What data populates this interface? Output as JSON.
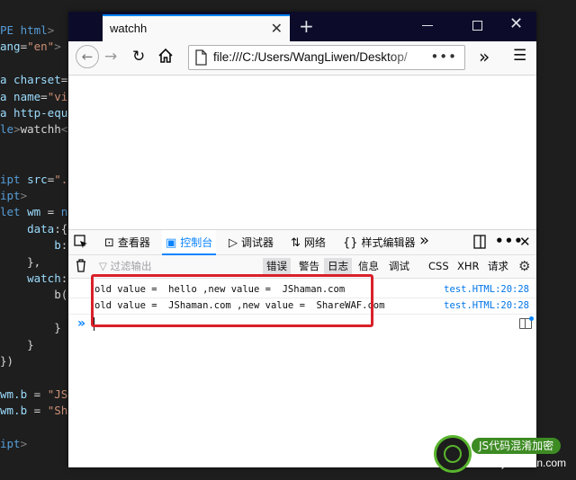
{
  "editor": {
    "lines": [
      {
        "parts": [
          {
            "c": "kw",
            "t": "PE html"
          },
          {
            "c": "tag",
            "t": ">"
          }
        ]
      },
      {
        "parts": [
          {
            "c": "attr",
            "t": "ang"
          },
          {
            "c": "txt",
            "t": "="
          },
          {
            "c": "str",
            "t": "\"en\""
          },
          {
            "c": "tag",
            "t": ">"
          }
        ]
      },
      {
        "parts": []
      },
      {
        "parts": [
          {
            "c": "attr",
            "t": "a charset"
          },
          {
            "c": "txt",
            "t": "="
          },
          {
            "c": "str",
            "t": "\""
          }
        ]
      },
      {
        "parts": [
          {
            "c": "attr",
            "t": "a name"
          },
          {
            "c": "txt",
            "t": "="
          },
          {
            "c": "str",
            "t": "\"vie"
          }
        ]
      },
      {
        "parts": [
          {
            "c": "attr",
            "t": "a http-equi"
          }
        ]
      },
      {
        "parts": [
          {
            "c": "kw",
            "t": "le"
          },
          {
            "c": "tag",
            "t": ">"
          },
          {
            "c": "txt",
            "t": "watchh"
          },
          {
            "c": "tag",
            "t": "</"
          }
        ]
      },
      {
        "parts": []
      },
      {
        "parts": []
      },
      {
        "parts": [
          {
            "c": "kw",
            "t": "ipt"
          },
          {
            "c": "attr",
            "t": " src"
          },
          {
            "c": "txt",
            "t": "="
          },
          {
            "c": "str",
            "t": "\"./"
          }
        ]
      },
      {
        "parts": [
          {
            "c": "kw",
            "t": "ipt"
          },
          {
            "c": "tag",
            "t": ">"
          }
        ]
      },
      {
        "parts": [
          {
            "c": "kw",
            "t": "let"
          },
          {
            "c": "prop",
            "t": " wm"
          },
          {
            "c": "txt",
            "t": " = "
          },
          {
            "c": "kw",
            "t": "ne"
          }
        ]
      },
      {
        "parts": [
          {
            "c": "prop",
            "t": "    data"
          },
          {
            "c": "txt",
            "t": ":{"
          }
        ]
      },
      {
        "parts": [
          {
            "c": "prop",
            "t": "        b"
          },
          {
            "c": "txt",
            "t": ":"
          }
        ]
      },
      {
        "parts": [
          {
            "c": "txt",
            "t": "    },"
          }
        ]
      },
      {
        "parts": [
          {
            "c": "prop",
            "t": "    watch"
          },
          {
            "c": "txt",
            "t": ":{"
          }
        ]
      },
      {
        "parts": [
          {
            "c": "txt",
            "t": "        b(n"
          }
        ]
      },
      {
        "parts": []
      },
      {
        "parts": [
          {
            "c": "txt",
            "t": "        }"
          }
        ]
      },
      {
        "parts": [
          {
            "c": "txt",
            "t": "    }"
          }
        ]
      },
      {
        "parts": [
          {
            "c": "txt",
            "t": "})"
          }
        ]
      },
      {
        "parts": []
      },
      {
        "parts": [
          {
            "c": "prop",
            "t": "wm.b"
          },
          {
            "c": "txt",
            "t": " = "
          },
          {
            "c": "str",
            "t": "\"JSh"
          }
        ]
      },
      {
        "parts": [
          {
            "c": "prop",
            "t": "wm.b"
          },
          {
            "c": "txt",
            "t": " = "
          },
          {
            "c": "str",
            "t": "\"Sha"
          }
        ]
      },
      {
        "parts": []
      },
      {
        "parts": [
          {
            "c": "kw",
            "t": "ipt"
          },
          {
            "c": "tag",
            "t": ">"
          }
        ]
      }
    ]
  },
  "browser": {
    "tab_title": "watchh",
    "tab_close": "✕",
    "new_tab": "+",
    "win_close": "✕",
    "url": "file:///C:/Users/WangLiwen/Desktop/",
    "url_more": "•••",
    "overflow": "»",
    "menu": "☰"
  },
  "devtools": {
    "tabs": [
      {
        "name": "inspector",
        "icon": "⊡",
        "label": "查看器",
        "active": false
      },
      {
        "name": "console",
        "icon": "▣",
        "label": "控制台",
        "active": true
      },
      {
        "name": "debugger",
        "icon": "▷",
        "label": "调试器",
        "active": false
      },
      {
        "name": "network",
        "icon": "⇅",
        "label": "网络",
        "active": false
      },
      {
        "name": "style-editor",
        "icon": "{}",
        "label": "样式编辑器",
        "active": false
      }
    ],
    "more_tabs": "»",
    "filter_placeholder": "▽ 过滤输出",
    "filters": [
      {
        "name": "errors",
        "label": "错误",
        "checked": true
      },
      {
        "name": "warnings",
        "label": "警告",
        "checked": false
      },
      {
        "name": "logs",
        "label": "日志",
        "checked": true
      },
      {
        "name": "info",
        "label": "信息",
        "checked": false
      },
      {
        "name": "debug",
        "label": "调试",
        "checked": false
      },
      {
        "name": "css",
        "label": "CSS",
        "checked": false
      },
      {
        "name": "xhr",
        "label": "XHR",
        "checked": false
      },
      {
        "name": "requests",
        "label": "请求",
        "checked": false
      }
    ],
    "logs": [
      {
        "message": "old value =  hello ,new value =  JShaman.com",
        "source": "test.HTML:20:28"
      },
      {
        "message": "old value =  JShaman.com ,new value =  ShareWAF.com",
        "source": "test.HTML:20:28"
      }
    ],
    "prompt": "»"
  },
  "watermark": {
    "title": "JS代码混淆加密",
    "url": "www.jshaman.com"
  },
  "colors": {
    "accent": "#0a84ff",
    "highlight": "#d9202a",
    "watermark_green": "#59b52d"
  }
}
